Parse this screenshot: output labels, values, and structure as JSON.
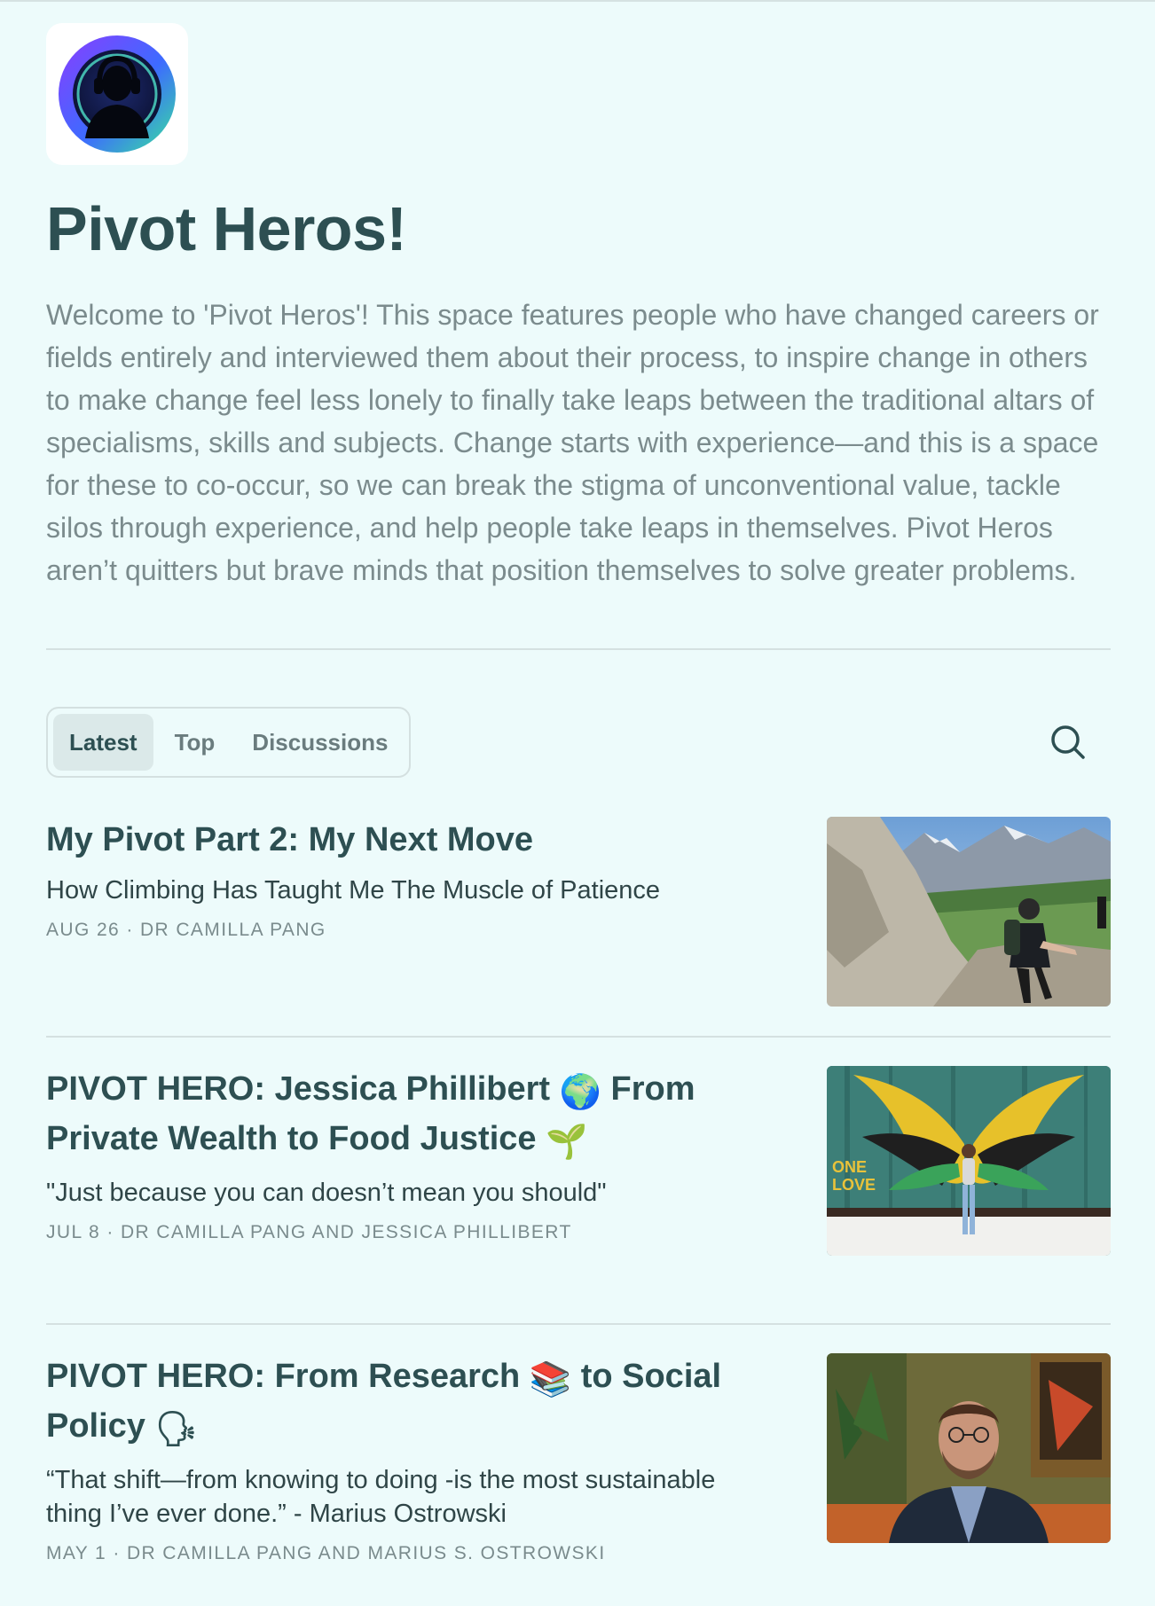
{
  "publication": {
    "title": "Pivot Heros!",
    "description": "Welcome to 'Pivot Heros'! This space features people who have changed careers or fields entirely and interviewed them about their process, to inspire change in others to make change feel less lonely to finally take leaps between the traditional altars of specialisms, skills and subjects. Change starts with experience—and this is a space for these to co-occur, so we can break the stigma of unconventional value, tackle silos through experience, and help people take leaps in themselves. Pivot Heros aren’t quitters but brave minds that position themselves to solve greater problems.",
    "logo_icon": "headphone-silhouette-logo"
  },
  "tabs": [
    {
      "label": "Latest",
      "active": true
    },
    {
      "label": "Top",
      "active": false
    },
    {
      "label": "Discussions",
      "active": false
    }
  ],
  "search": {
    "icon": "search-icon"
  },
  "posts": [
    {
      "title": "My Pivot Part 2: My Next Move",
      "subtitle": "How Climbing Has Taught Me The Muscle of Patience",
      "meta": "AUG 26 · DR CAMILLA PANG",
      "thumbnail_icon": "mountain-climber-photo"
    },
    {
      "title_part1": "PIVOT HERO: Jessica Phillibert ",
      "title_emoji1": "🌍",
      "title_part2": " From Private Wealth to Food Justice ",
      "title_emoji2": "🌱",
      "subtitle": "\"Just because you can doesn’t mean you should\"",
      "meta": "JUL 8 · DR CAMILLA PANG AND JESSICA PHILLIBERT",
      "thumbnail_icon": "wings-mural-photo",
      "thumbnail_text1": "ONE",
      "thumbnail_text2": "LOVE"
    },
    {
      "title_part1": "PIVOT HERO: From Research ",
      "title_emoji1": "📚",
      "title_part2": " to Social Policy ",
      "title_emoji2": "🗣",
      "subtitle": "“That shift—from knowing to doing -is the most sustainable thing I’ve ever done.” - Marius Ostrowski",
      "meta": "MAY 1 · DR CAMILLA PANG AND MARIUS S. OSTROWSKI",
      "thumbnail_icon": "portrait-photo"
    }
  ]
}
